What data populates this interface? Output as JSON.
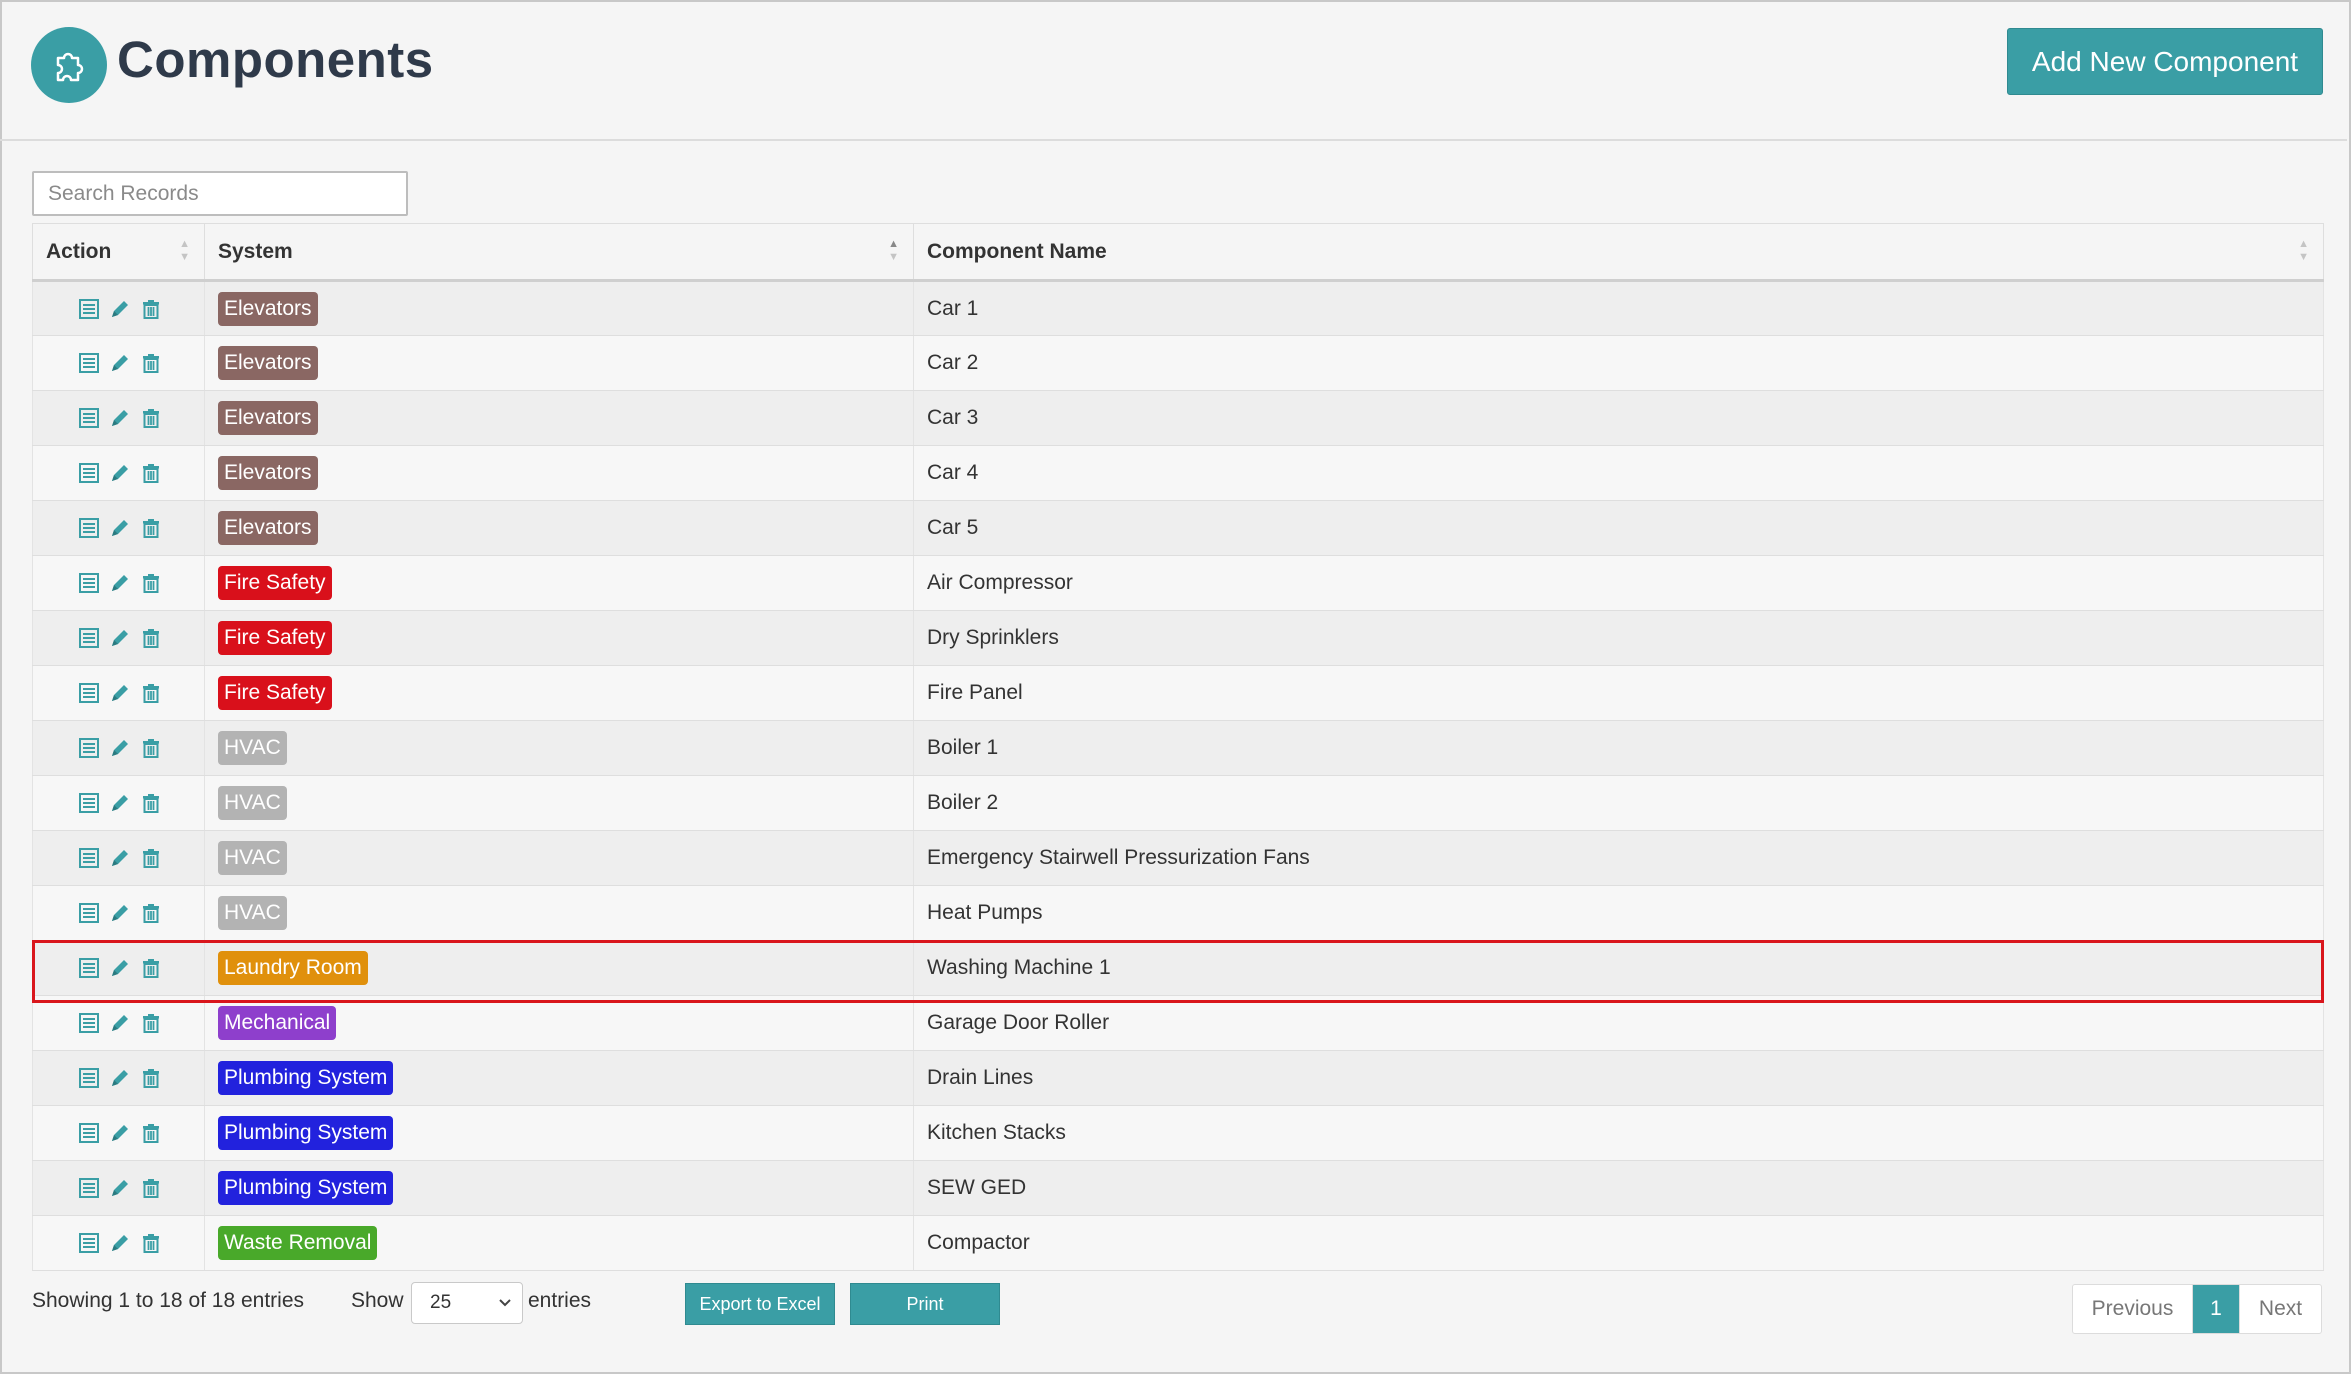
{
  "header": {
    "title": "Components",
    "add_button_label": "Add New Component"
  },
  "search": {
    "placeholder": "Search Records",
    "value": ""
  },
  "table": {
    "columns": [
      "Action",
      "System",
      "Component Name"
    ],
    "rows": [
      {
        "system": "Elevators",
        "component": "Car 1",
        "color": "#8a6763"
      },
      {
        "system": "Elevators",
        "component": "Car 2",
        "color": "#8a6763"
      },
      {
        "system": "Elevators",
        "component": "Car 3",
        "color": "#8a6763"
      },
      {
        "system": "Elevators",
        "component": "Car 4",
        "color": "#8a6763"
      },
      {
        "system": "Elevators",
        "component": "Car 5",
        "color": "#8a6763"
      },
      {
        "system": "Fire Safety",
        "component": "Air Compressor",
        "color": "#d9101b"
      },
      {
        "system": "Fire Safety",
        "component": "Dry Sprinklers",
        "color": "#d9101b"
      },
      {
        "system": "Fire Safety",
        "component": "Fire Panel",
        "color": "#d9101b"
      },
      {
        "system": "HVAC",
        "component": "Boiler 1",
        "color": "#b3b3b3"
      },
      {
        "system": "HVAC",
        "component": "Boiler 2",
        "color": "#b3b3b3"
      },
      {
        "system": "HVAC",
        "component": "Emergency Stairwell Pressurization Fans",
        "color": "#b3b3b3"
      },
      {
        "system": "HVAC",
        "component": "Heat Pumps",
        "color": "#b3b3b3"
      },
      {
        "system": "Laundry Room",
        "component": "Washing Machine 1",
        "color": "#e0900c"
      },
      {
        "system": "Mechanical",
        "component": "Garage Door Roller",
        "color": "#8e3fcc"
      },
      {
        "system": "Plumbing System",
        "component": "Drain Lines",
        "color": "#2222dd"
      },
      {
        "system": "Plumbing System",
        "component": "Kitchen Stacks",
        "color": "#2222dd"
      },
      {
        "system": "Plumbing System",
        "component": "SEW GED",
        "color": "#2222dd"
      },
      {
        "system": "Waste Removal",
        "component": "Compactor",
        "color": "#49a92a"
      }
    ],
    "action_icons": [
      "details-icon",
      "edit-pencil-icon",
      "trash-icon"
    ]
  },
  "footer": {
    "info": "Showing 1 to 18 of 18 entries",
    "show_label": "Show",
    "page_size": "25",
    "entries_label": "entries",
    "export_label": "Export to Excel",
    "print_label": "Print",
    "prev_label": "Previous",
    "current_page": "1",
    "next_label": "Next"
  },
  "colors": {
    "accent": "#3a9ea5",
    "highlight": "#d9161c"
  }
}
